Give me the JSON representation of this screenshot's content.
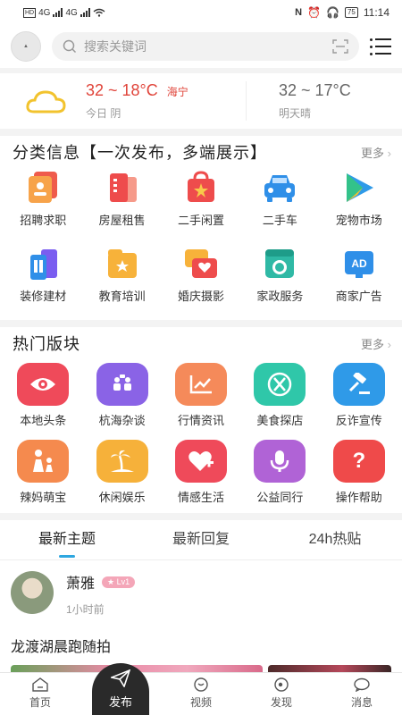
{
  "statusbar": {
    "time": "11:14",
    "battery": "75",
    "net1": "4G",
    "net2": "4G"
  },
  "topbar": {
    "search_placeholder": "搜索关键词"
  },
  "weather": {
    "today_temp": "32 ~ 18°C",
    "city": "海宁",
    "today_label": "今日 阴",
    "tomorrow_temp": "32 ~ 17°C",
    "tomorrow_label": "明天晴"
  },
  "categories": {
    "title": "分类信息【一次发布，多端展示】",
    "more": "更多",
    "items": [
      {
        "label": "招聘求职",
        "icon": "job-icon"
      },
      {
        "label": "房屋租售",
        "icon": "house-icon"
      },
      {
        "label": "二手闲置",
        "icon": "secondhand-icon"
      },
      {
        "label": "二手车",
        "icon": "car-icon"
      },
      {
        "label": "宠物市场",
        "icon": "pet-icon"
      },
      {
        "label": "装修建材",
        "icon": "decoration-icon"
      },
      {
        "label": "教育培训",
        "icon": "education-icon"
      },
      {
        "label": "婚庆摄影",
        "icon": "wedding-icon"
      },
      {
        "label": "家政服务",
        "icon": "housekeeping-icon"
      },
      {
        "label": "商家广告",
        "icon": "ad-icon"
      }
    ]
  },
  "hot": {
    "title": "热门版块",
    "more": "更多",
    "items": [
      {
        "label": "本地头条",
        "icon": "eye-icon",
        "color": "#ef4a5a"
      },
      {
        "label": "杭海杂谈",
        "icon": "chat-icon",
        "color": "#8a63e6"
      },
      {
        "label": "行情资讯",
        "icon": "trend-icon",
        "color": "#f58a5a"
      },
      {
        "label": "美食探店",
        "icon": "food-icon",
        "color": "#2fc7a9"
      },
      {
        "label": "反诈宣传",
        "icon": "gavel-icon",
        "color": "#2f9ae8"
      },
      {
        "label": "辣妈萌宝",
        "icon": "family-icon",
        "color": "#f58a4e"
      },
      {
        "label": "休闲娱乐",
        "icon": "palm-icon",
        "color": "#f6b13a"
      },
      {
        "label": "情感生活",
        "icon": "heart-plus-icon",
        "color": "#ef4a5a"
      },
      {
        "label": "公益同行",
        "icon": "mic-icon",
        "color": "#b063d6"
      },
      {
        "label": "操作帮助",
        "icon": "help-icon",
        "color": "#ef4a4a"
      }
    ]
  },
  "tabs": [
    "最新主题",
    "最新回复",
    "24h热贴"
  ],
  "post": {
    "author": "萧雅",
    "level": "Lv1",
    "time": "1小时前",
    "title": "龙渡湖晨跑随拍"
  },
  "bottomnav": {
    "home": "首页",
    "publish": "发布",
    "video": "视频",
    "discover": "发现",
    "message": "消息"
  }
}
